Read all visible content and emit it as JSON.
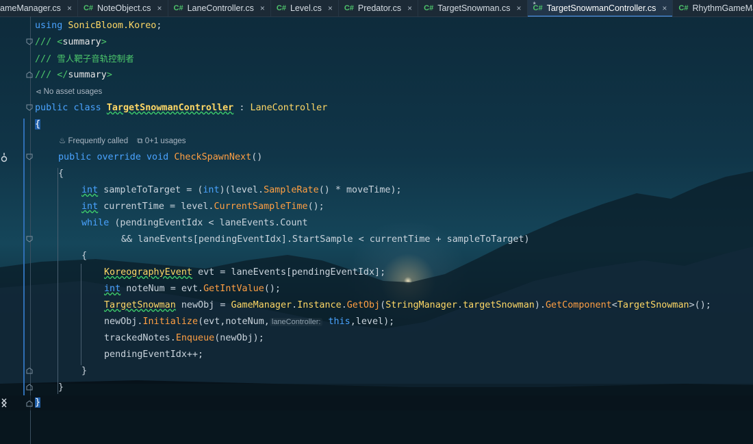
{
  "tabs": [
    {
      "label": "ameManager.cs",
      "active": false,
      "cs": false
    },
    {
      "label": "NoteObject.cs",
      "active": false,
      "cs": true
    },
    {
      "label": "LaneController.cs",
      "active": false,
      "cs": true
    },
    {
      "label": "Level.cs",
      "active": false,
      "cs": true
    },
    {
      "label": "Predator.cs",
      "active": false,
      "cs": true
    },
    {
      "label": "TargetSnowman.cs",
      "active": false,
      "cs": true
    },
    {
      "label": "TargetSnowmanController.cs",
      "active": true,
      "cs": true,
      "modified": true
    },
    {
      "label": "RhythmGameManager.cs",
      "active": false,
      "cs": true
    }
  ],
  "tab_lang_badge": "C#",
  "modified_mark": "*",
  "close_glyph": "×",
  "code": {
    "l1": {
      "kw": "using",
      "ns": "SonicBloom.Koreo",
      "semi": ";"
    },
    "l2": {
      "slashes": "///",
      "open": "<",
      "tag": "summary",
      "close": ">"
    },
    "l3": {
      "slashes": "///",
      "text": "雪人靶子音轨控制者"
    },
    "l4": {
      "slashes": "///",
      "open": "</",
      "tag": "summary",
      "close": ">"
    },
    "meta1": "No asset usages",
    "l5": {
      "kw1": "public",
      "kw2": "class",
      "name": "TargetSnowmanController",
      "colon": ":",
      "base": "LaneController"
    },
    "l6": "{",
    "meta2a": "Frequently called",
    "meta2b": "0+1 usages",
    "l7": {
      "kw1": "public",
      "kw2": "override",
      "kw3": "void",
      "name": "CheckSpawnNext",
      "parens": "()"
    },
    "l8": "{",
    "l9": {
      "type": "int",
      "var": "sampleToTarget",
      "eq": "=",
      "cast_open": "(",
      "cast": "int",
      "cast_close": ")(",
      "obj": "level.",
      "method": "SampleRate",
      "rest": "() * moveTime);"
    },
    "l10": {
      "type": "int",
      "var": "currentTime",
      "eq": "=",
      "obj": "level.",
      "method": "CurrentSampleTime",
      "rest": "();"
    },
    "l11": {
      "kw": "while",
      "rest": "(pendingEventIdx < laneEvents.Count"
    },
    "l12": {
      "rest": "&& laneEvents[pendingEventIdx].StartSample < currentTime + sampleToTarget)"
    },
    "l13": "{",
    "l14": {
      "type": "KoreographyEvent",
      "rest": "evt = laneEvents[pendingEventIdx];"
    },
    "l15": {
      "type": "int",
      "var": "noteNum",
      "eq": "=",
      "obj": "evt.",
      "method": "GetIntValue",
      "rest": "();"
    },
    "l16": {
      "type": "TargetSnowman",
      "var": "newObj",
      "eq": "=",
      "cls": "GameManager",
      "dot1": ".",
      "inst": "Instance",
      "dot2": ".",
      "m1": "GetObj",
      "po": "(",
      "cls2": "StringManager",
      "dot3": ".",
      "fld": "targetSnowman",
      "pc": ")",
      "dot4": ".",
      "m2": "GetComponent",
      "lt": "<",
      "gen": "TargetSnowman",
      "end": ">();"
    },
    "l17": {
      "obj": "newObj.",
      "method": "Initialize",
      "args1": "(evt,noteNum,",
      "hint": "laneController:",
      "kw": "this",
      "args2": ",level);"
    },
    "l18": {
      "obj": "trackedNotes.",
      "method": "Enqueue",
      "rest": "(newObj);"
    },
    "l19": "pendingEventIdx++;",
    "l20": "}",
    "l21": "}",
    "l22": "}"
  }
}
